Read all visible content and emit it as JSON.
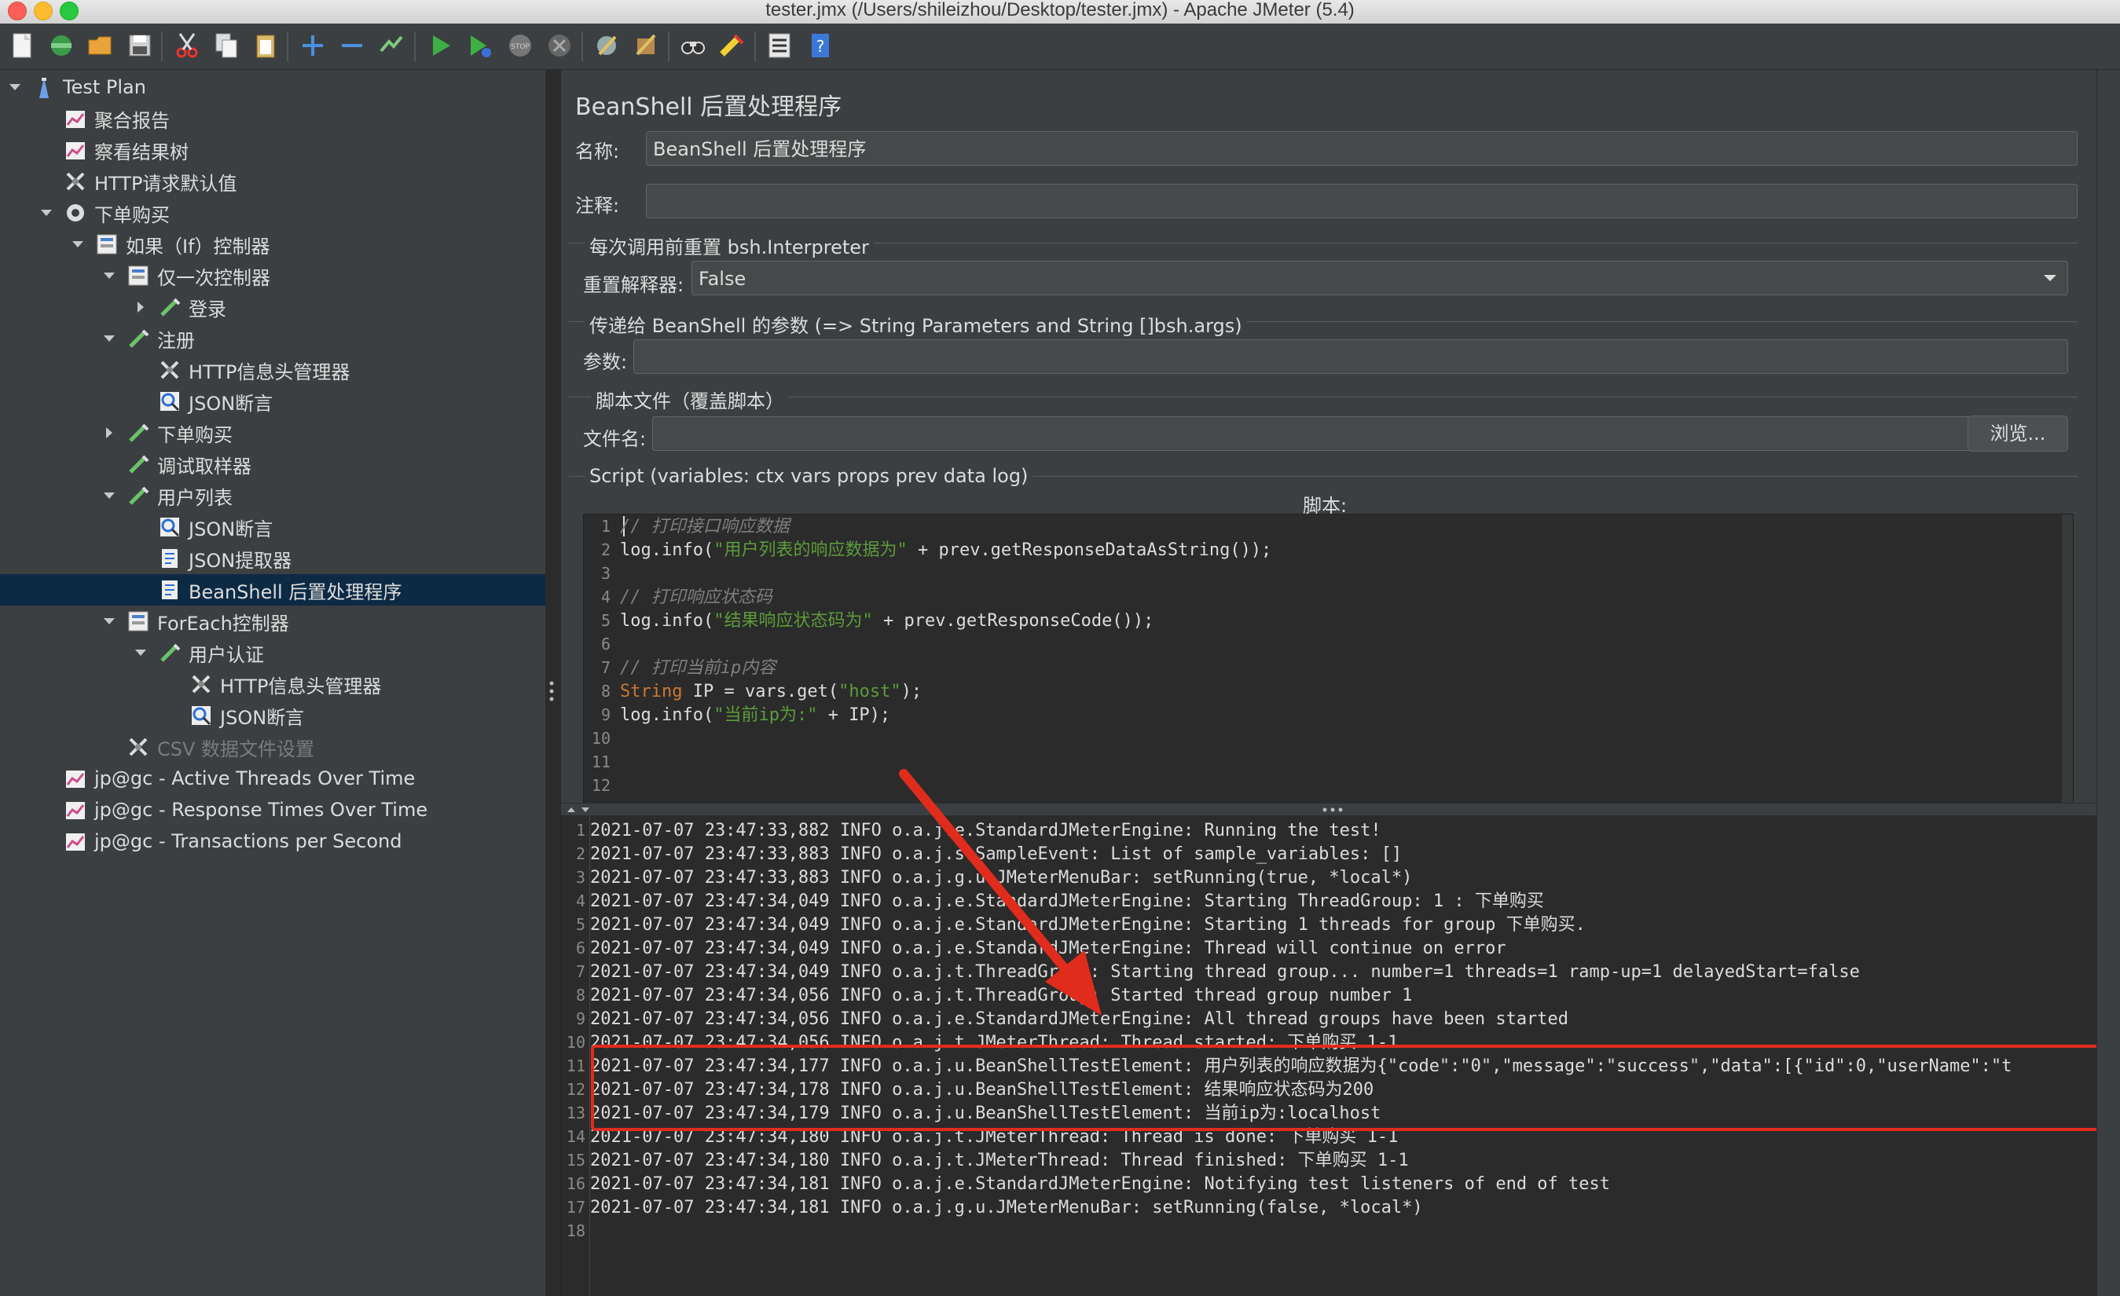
{
  "window": {
    "title": "tester.jmx (/Users/shileizhou/Desktop/tester.jmx) - Apache JMeter (5.4)"
  },
  "toolbar": {
    "icons": [
      "new-icon",
      "templates-icon",
      "open-icon",
      "save-icon",
      "cut-icon",
      "copy-icon",
      "paste-icon",
      "expand-icon",
      "collapse-icon",
      "toggle-icon",
      "start-icon",
      "start-no-pause-icon",
      "stop-icon",
      "shutdown-icon",
      "clear-icon",
      "clear-all-icon",
      "search-icon",
      "reset-search-icon",
      "function-helper-icon",
      "help-icon"
    ]
  },
  "tree": {
    "items": [
      {
        "label": "Test Plan",
        "icon": "test-plan-icon",
        "level": 0,
        "arrow": "down"
      },
      {
        "label": "聚合报告",
        "icon": "listener-icon",
        "level": 1,
        "arrow": ""
      },
      {
        "label": "察看结果树",
        "icon": "listener-icon",
        "level": 1,
        "arrow": ""
      },
      {
        "label": "HTTP请求默认值",
        "icon": "config-icon",
        "level": 1,
        "arrow": ""
      },
      {
        "label": "下单购买",
        "icon": "thread-group-icon",
        "level": 1,
        "arrow": "down"
      },
      {
        "label": "如果（If）控制器",
        "icon": "controller-icon",
        "level": 2,
        "arrow": "down"
      },
      {
        "label": "仅一次控制器",
        "icon": "controller-icon",
        "level": 3,
        "arrow": "down"
      },
      {
        "label": "登录",
        "icon": "sampler-icon",
        "level": 4,
        "arrow": "right"
      },
      {
        "label": "注册",
        "icon": "sampler-icon",
        "level": 3,
        "arrow": "down"
      },
      {
        "label": "HTTP信息头管理器",
        "icon": "config-icon",
        "level": 4,
        "arrow": ""
      },
      {
        "label": "JSON断言",
        "icon": "assertion-icon",
        "level": 4,
        "arrow": ""
      },
      {
        "label": "下单购买",
        "icon": "sampler-icon",
        "level": 3,
        "arrow": "right"
      },
      {
        "label": "调试取样器",
        "icon": "sampler-icon",
        "level": 3,
        "arrow": ""
      },
      {
        "label": "用户列表",
        "icon": "sampler-icon",
        "level": 3,
        "arrow": "down"
      },
      {
        "label": "JSON断言",
        "icon": "assertion-icon",
        "level": 4,
        "arrow": ""
      },
      {
        "label": "JSON提取器",
        "icon": "post-processor-icon",
        "level": 4,
        "arrow": ""
      },
      {
        "label": "BeanShell 后置处理程序",
        "icon": "post-processor-icon",
        "level": 4,
        "arrow": "",
        "selected": true
      },
      {
        "label": "ForEach控制器",
        "icon": "controller-icon",
        "level": 3,
        "arrow": "down"
      },
      {
        "label": "用户认证",
        "icon": "sampler-icon",
        "level": 4,
        "arrow": "down"
      },
      {
        "label": "HTTP信息头管理器",
        "icon": "config-icon",
        "level": 5,
        "arrow": ""
      },
      {
        "label": "JSON断言",
        "icon": "assertion-icon",
        "level": 5,
        "arrow": ""
      },
      {
        "label": "CSV 数据文件设置",
        "icon": "config-icon",
        "level": 3,
        "arrow": "",
        "disabled": true
      },
      {
        "label": "jp@gc - Active Threads Over Time",
        "icon": "listener-icon",
        "level": 1,
        "arrow": ""
      },
      {
        "label": "jp@gc - Response Times Over Time",
        "icon": "listener-icon",
        "level": 1,
        "arrow": ""
      },
      {
        "label": "jp@gc - Transactions per Second",
        "icon": "listener-icon",
        "level": 1,
        "arrow": ""
      }
    ]
  },
  "panel": {
    "heading": "BeanShell 后置处理程序",
    "name_label": "名称:",
    "name_value": "BeanShell 后置处理程序",
    "comment_label": "注释:",
    "comment_value": "",
    "reset_group": "每次调用前重置 bsh.Interpreter",
    "reset_label": "重置解释器:",
    "reset_value": "False",
    "params_group": "传递给 BeanShell 的参数 (=> String Parameters and String []bsh.args)",
    "params_label": "参数:",
    "params_value": "",
    "file_group": "脚本文件（覆盖脚本）",
    "file_label": "文件名:",
    "file_value": "",
    "browse_label": "浏览...",
    "script_group": "Script (variables: ctx vars props prev data log)",
    "script_label": "脚本:"
  },
  "script": {
    "lines": [
      {
        "n": "1",
        "parts": [
          {
            "t": "// 打印接口响应数据",
            "c": "c-comment"
          }
        ]
      },
      {
        "n": "2",
        "parts": [
          {
            "t": "log.info(",
            "c": "c-plain"
          },
          {
            "t": "\"用户列表的响应数据为\"",
            "c": "c-str"
          },
          {
            "t": " + prev.getResponseDataAsString());",
            "c": "c-plain"
          }
        ]
      },
      {
        "n": "3",
        "parts": []
      },
      {
        "n": "4",
        "parts": [
          {
            "t": "// 打印响应状态码",
            "c": "c-comment"
          }
        ]
      },
      {
        "n": "5",
        "parts": [
          {
            "t": "log.info(",
            "c": "c-plain"
          },
          {
            "t": "\"结果响应状态码为\"",
            "c": "c-str"
          },
          {
            "t": " + prev.getResponseCode());",
            "c": "c-plain"
          }
        ]
      },
      {
        "n": "6",
        "parts": []
      },
      {
        "n": "7",
        "parts": [
          {
            "t": "// 打印当前ip内容",
            "c": "c-comment"
          }
        ]
      },
      {
        "n": "8",
        "parts": [
          {
            "t": "String",
            "c": "c-kw"
          },
          {
            "t": " IP = vars.get(",
            "c": "c-plain"
          },
          {
            "t": "\"host\"",
            "c": "c-str"
          },
          {
            "t": ");",
            "c": "c-plain"
          }
        ]
      },
      {
        "n": "9",
        "parts": [
          {
            "t": "log.info(",
            "c": "c-plain"
          },
          {
            "t": "\"当前ip为:\"",
            "c": "c-str"
          },
          {
            "t": " + IP);",
            "c": "c-plain"
          }
        ]
      },
      {
        "n": "10",
        "parts": []
      },
      {
        "n": "11",
        "parts": []
      },
      {
        "n": "12",
        "parts": []
      }
    ]
  },
  "log": {
    "lines": [
      {
        "n": "1",
        "text": "2021-07-07 23:47:33,882 INFO o.a.j.e.StandardJMeterEngine: Running the test!"
      },
      {
        "n": "2",
        "text": "2021-07-07 23:47:33,883 INFO o.a.j.s.SampleEvent: List of sample_variables: []"
      },
      {
        "n": "3",
        "text": "2021-07-07 23:47:33,883 INFO o.a.j.g.u.JMeterMenuBar: setRunning(true, *local*)"
      },
      {
        "n": "4",
        "text": "2021-07-07 23:47:34,049 INFO o.a.j.e.StandardJMeterEngine: Starting ThreadGroup: 1 : 下单购买"
      },
      {
        "n": "5",
        "text": "2021-07-07 23:47:34,049 INFO o.a.j.e.StandardJMeterEngine: Starting 1 threads for group 下单购买."
      },
      {
        "n": "6",
        "text": "2021-07-07 23:47:34,049 INFO o.a.j.e.StandardJMeterEngine: Thread will continue on error"
      },
      {
        "n": "7",
        "text": "2021-07-07 23:47:34,049 INFO o.a.j.t.ThreadGroup: Starting thread group... number=1 threads=1 ramp-up=1 delayedStart=false"
      },
      {
        "n": "8",
        "text": "2021-07-07 23:47:34,056 INFO o.a.j.t.ThreadGroup: Started thread group number 1"
      },
      {
        "n": "9",
        "text": "2021-07-07 23:47:34,056 INFO o.a.j.e.StandardJMeterEngine: All thread groups have been started"
      },
      {
        "n": "10",
        "text": "2021-07-07 23:47:34,056 INFO o.a.j.t.JMeterThread: Thread started: 下单购买 1-1"
      },
      {
        "n": "11",
        "text": "2021-07-07 23:47:34,177 INFO o.a.j.u.BeanShellTestElement: 用户列表的响应数据为{\"code\":\"0\",\"message\":\"success\",\"data\":[{\"id\":0,\"userName\":\"t"
      },
      {
        "n": "12",
        "text": "2021-07-07 23:47:34,178 INFO o.a.j.u.BeanShellTestElement: 结果响应状态码为200"
      },
      {
        "n": "13",
        "text": "2021-07-07 23:47:34,179 INFO o.a.j.u.BeanShellTestElement: 当前ip为:localhost"
      },
      {
        "n": "14",
        "text": "2021-07-07 23:47:34,180 INFO o.a.j.t.JMeterThread: Thread is done: 下单购买 1-1"
      },
      {
        "n": "15",
        "text": "2021-07-07 23:47:34,180 INFO o.a.j.t.JMeterThread: Thread finished: 下单购买 1-1"
      },
      {
        "n": "16",
        "text": "2021-07-07 23:47:34,181 INFO o.a.j.e.StandardJMeterEngine: Notifying test listeners of end of test"
      },
      {
        "n": "17",
        "text": "2021-07-07 23:47:34,181 INFO o.a.j.g.u.JMeterMenuBar: setRunning(false, *local*)"
      },
      {
        "n": "18",
        "text": ""
      }
    ]
  },
  "colors": {
    "accent": "#e02c1c",
    "selected": "#0d2a45",
    "string": "#5c9c3a",
    "keyword": "#cc7832"
  }
}
